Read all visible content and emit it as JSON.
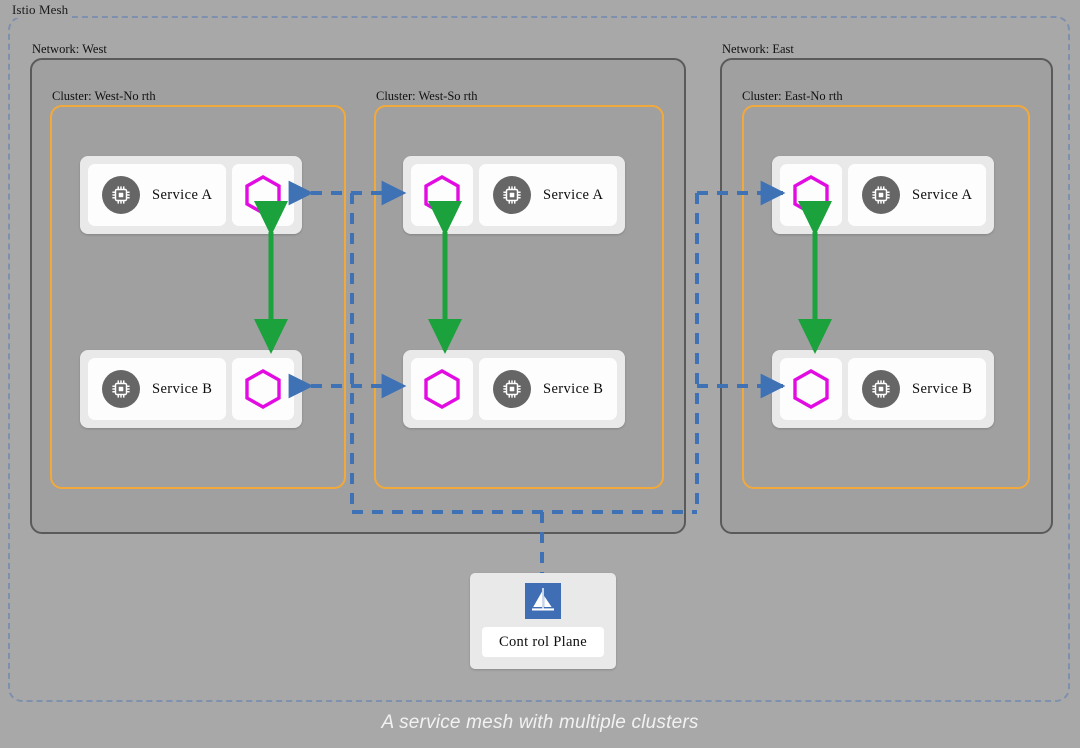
{
  "mesh": {
    "label": "Istio Mesh",
    "boundary_color": "#7d90ad"
  },
  "caption": "A service mesh with multiple clusters",
  "colors": {
    "background": "#a8a8a8",
    "network_border": "#5a5a5a",
    "cluster_border": "#f2a93b",
    "proxy_hex": "#e20ce2",
    "sync_arrow": "#1ba23c",
    "mesh_link": "#4a7ebb",
    "service_icon_bg": "#666666",
    "control_plane_logo_bg": "#3f6eb5"
  },
  "networks": [
    {
      "id": "west",
      "label": "Network:  West",
      "clusters": [
        {
          "id": "west-north",
          "label": "Cluster:  West-No rth",
          "layout": "service-left",
          "services": [
            {
              "name": "Service A",
              "icon": "chip-icon",
              "proxy": "envoy-hexagon-icon"
            },
            {
              "name": "Service B",
              "icon": "chip-icon",
              "proxy": "envoy-hexagon-icon"
            }
          ]
        },
        {
          "id": "west-south",
          "label": "Cluster:  West-So rth",
          "layout": "proxy-left",
          "services": [
            {
              "name": "Service A",
              "icon": "chip-icon",
              "proxy": "envoy-hexagon-icon"
            },
            {
              "name": "Service B",
              "icon": "chip-icon",
              "proxy": "envoy-hexagon-icon"
            }
          ]
        }
      ]
    },
    {
      "id": "east",
      "label": "Network: East",
      "clusters": [
        {
          "id": "east-north",
          "label": "Cluster: East-No rth",
          "layout": "proxy-left",
          "services": [
            {
              "name": "Service A",
              "icon": "chip-icon",
              "proxy": "envoy-hexagon-icon"
            },
            {
              "name": "Service B",
              "icon": "chip-icon",
              "proxy": "envoy-hexagon-icon"
            }
          ]
        }
      ]
    }
  ],
  "control_plane": {
    "label": "Cont rol Plane",
    "logo": "istio-sailboat-icon"
  }
}
